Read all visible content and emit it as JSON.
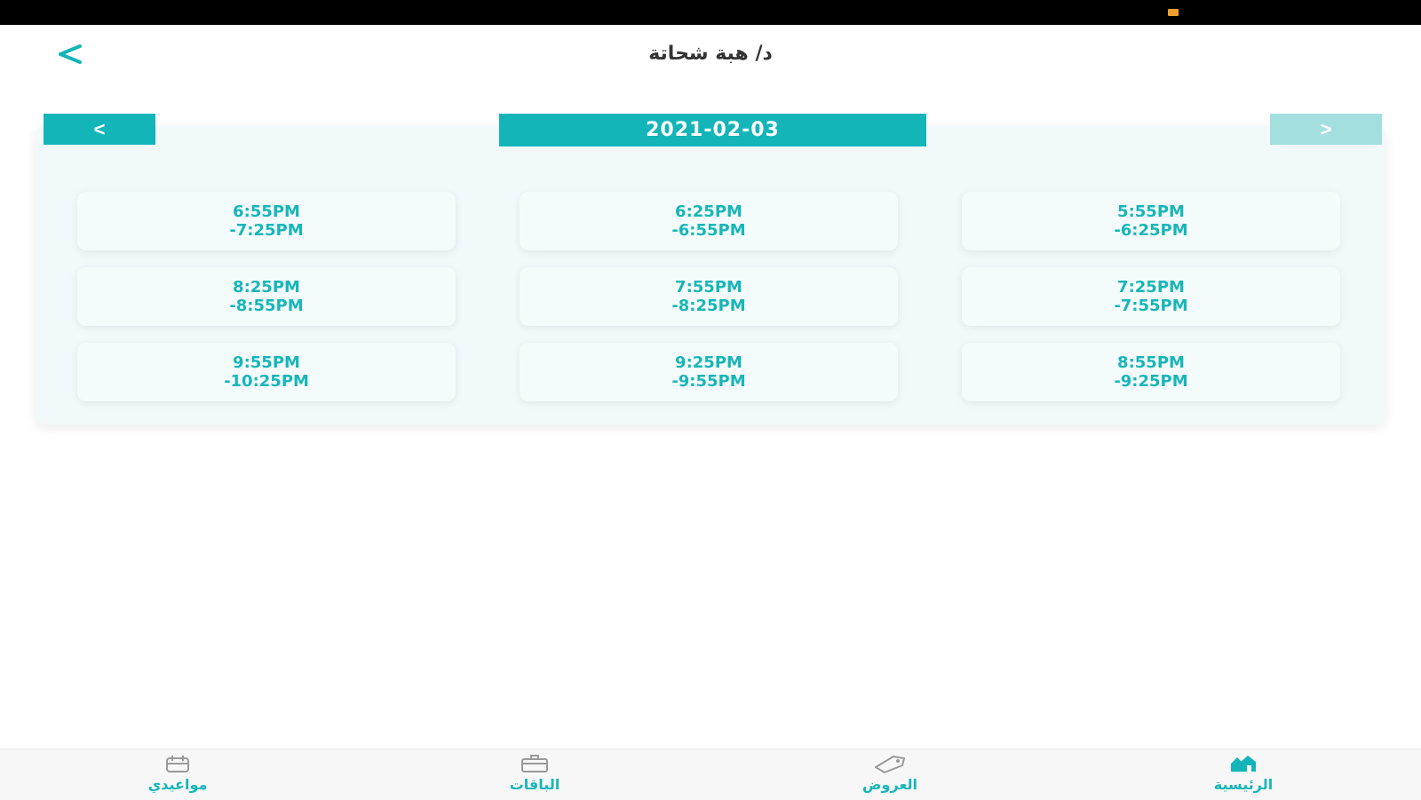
{
  "header": {
    "title": "د/ هبة شحاتة",
    "back_icon": "chevron-left-icon"
  },
  "date_nav": {
    "prev_label": "<",
    "next_label": ">",
    "date": "2021-02-03"
  },
  "slots": [
    {
      "start": "5:55PM",
      "end": "-6:25PM"
    },
    {
      "start": "6:25PM",
      "end": "-6:55PM"
    },
    {
      "start": "6:55PM",
      "end": "-7:25PM"
    },
    {
      "start": "7:25PM",
      "end": "-7:55PM"
    },
    {
      "start": "7:55PM",
      "end": "-8:25PM"
    },
    {
      "start": "8:25PM",
      "end": "-8:55PM"
    },
    {
      "start": "8:55PM",
      "end": "-9:25PM"
    },
    {
      "start": "9:25PM",
      "end": "-9:55PM"
    },
    {
      "start": "9:55PM",
      "end": "-10:25PM"
    }
  ],
  "tabbar": {
    "items": [
      {
        "label": "الرئيسية",
        "icon": "home-icon",
        "active": true
      },
      {
        "label": "العروض",
        "icon": "tag-icon",
        "active": false
      },
      {
        "label": "الباقات",
        "icon": "package-icon",
        "active": false
      },
      {
        "label": "مواعيدي",
        "icon": "calendar-icon",
        "active": false
      }
    ]
  },
  "colors": {
    "accent": "#13b5b9",
    "accent_disabled": "#a4dfe0",
    "card_bg": "#f2f9fa",
    "status_bar": "#000000"
  }
}
